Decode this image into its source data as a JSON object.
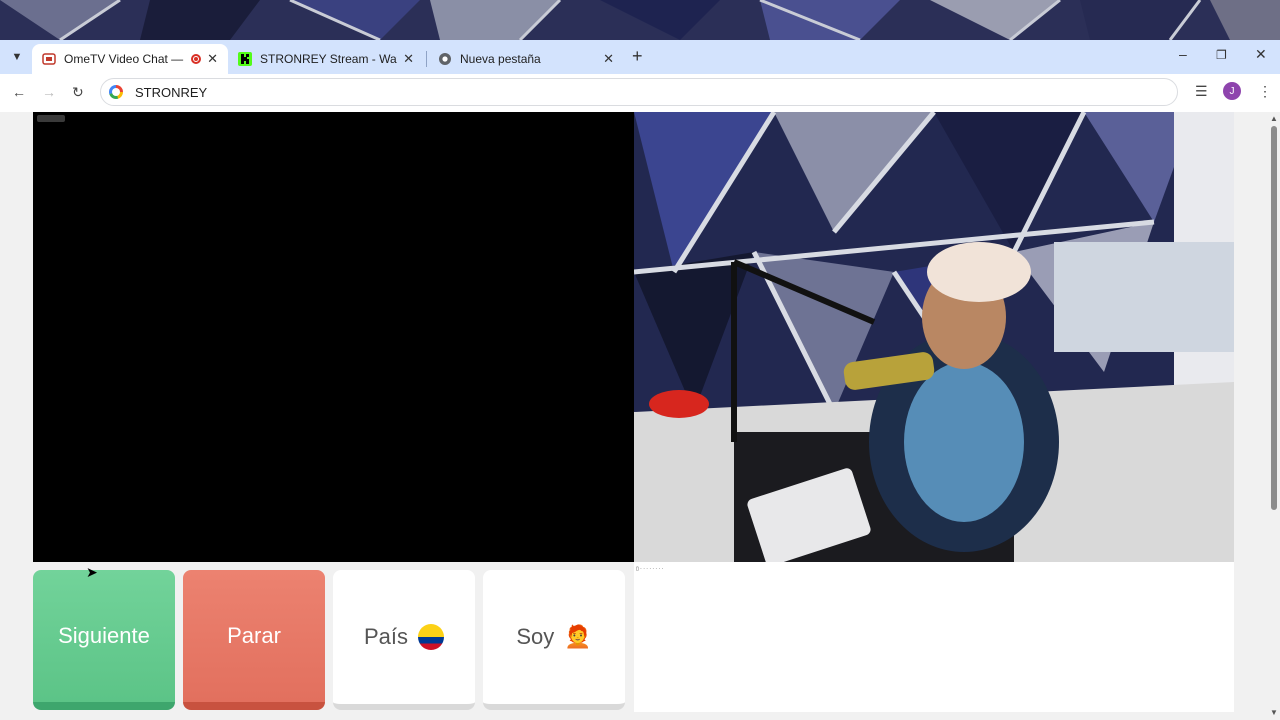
{
  "browser": {
    "tabs": [
      {
        "title": "OmeTV Video Chat — Ome",
        "active": true,
        "recording": true
      },
      {
        "title": "STRONREY Stream - Watch Live",
        "active": false
      },
      {
        "title": "Nueva pestaña",
        "active": false
      }
    ],
    "address": "STRONREY",
    "profile_initial": "J"
  },
  "buttons": {
    "next": "Siguiente",
    "stop": "Parar",
    "country": "País",
    "me": "Soy"
  },
  "icons": {
    "country_flag": "colombia-flag",
    "me_emoji": "🧑‍🦰"
  },
  "colors": {
    "next": "#5cc487",
    "stop": "#e2705e",
    "tabstrip": "#d3e3fd"
  }
}
